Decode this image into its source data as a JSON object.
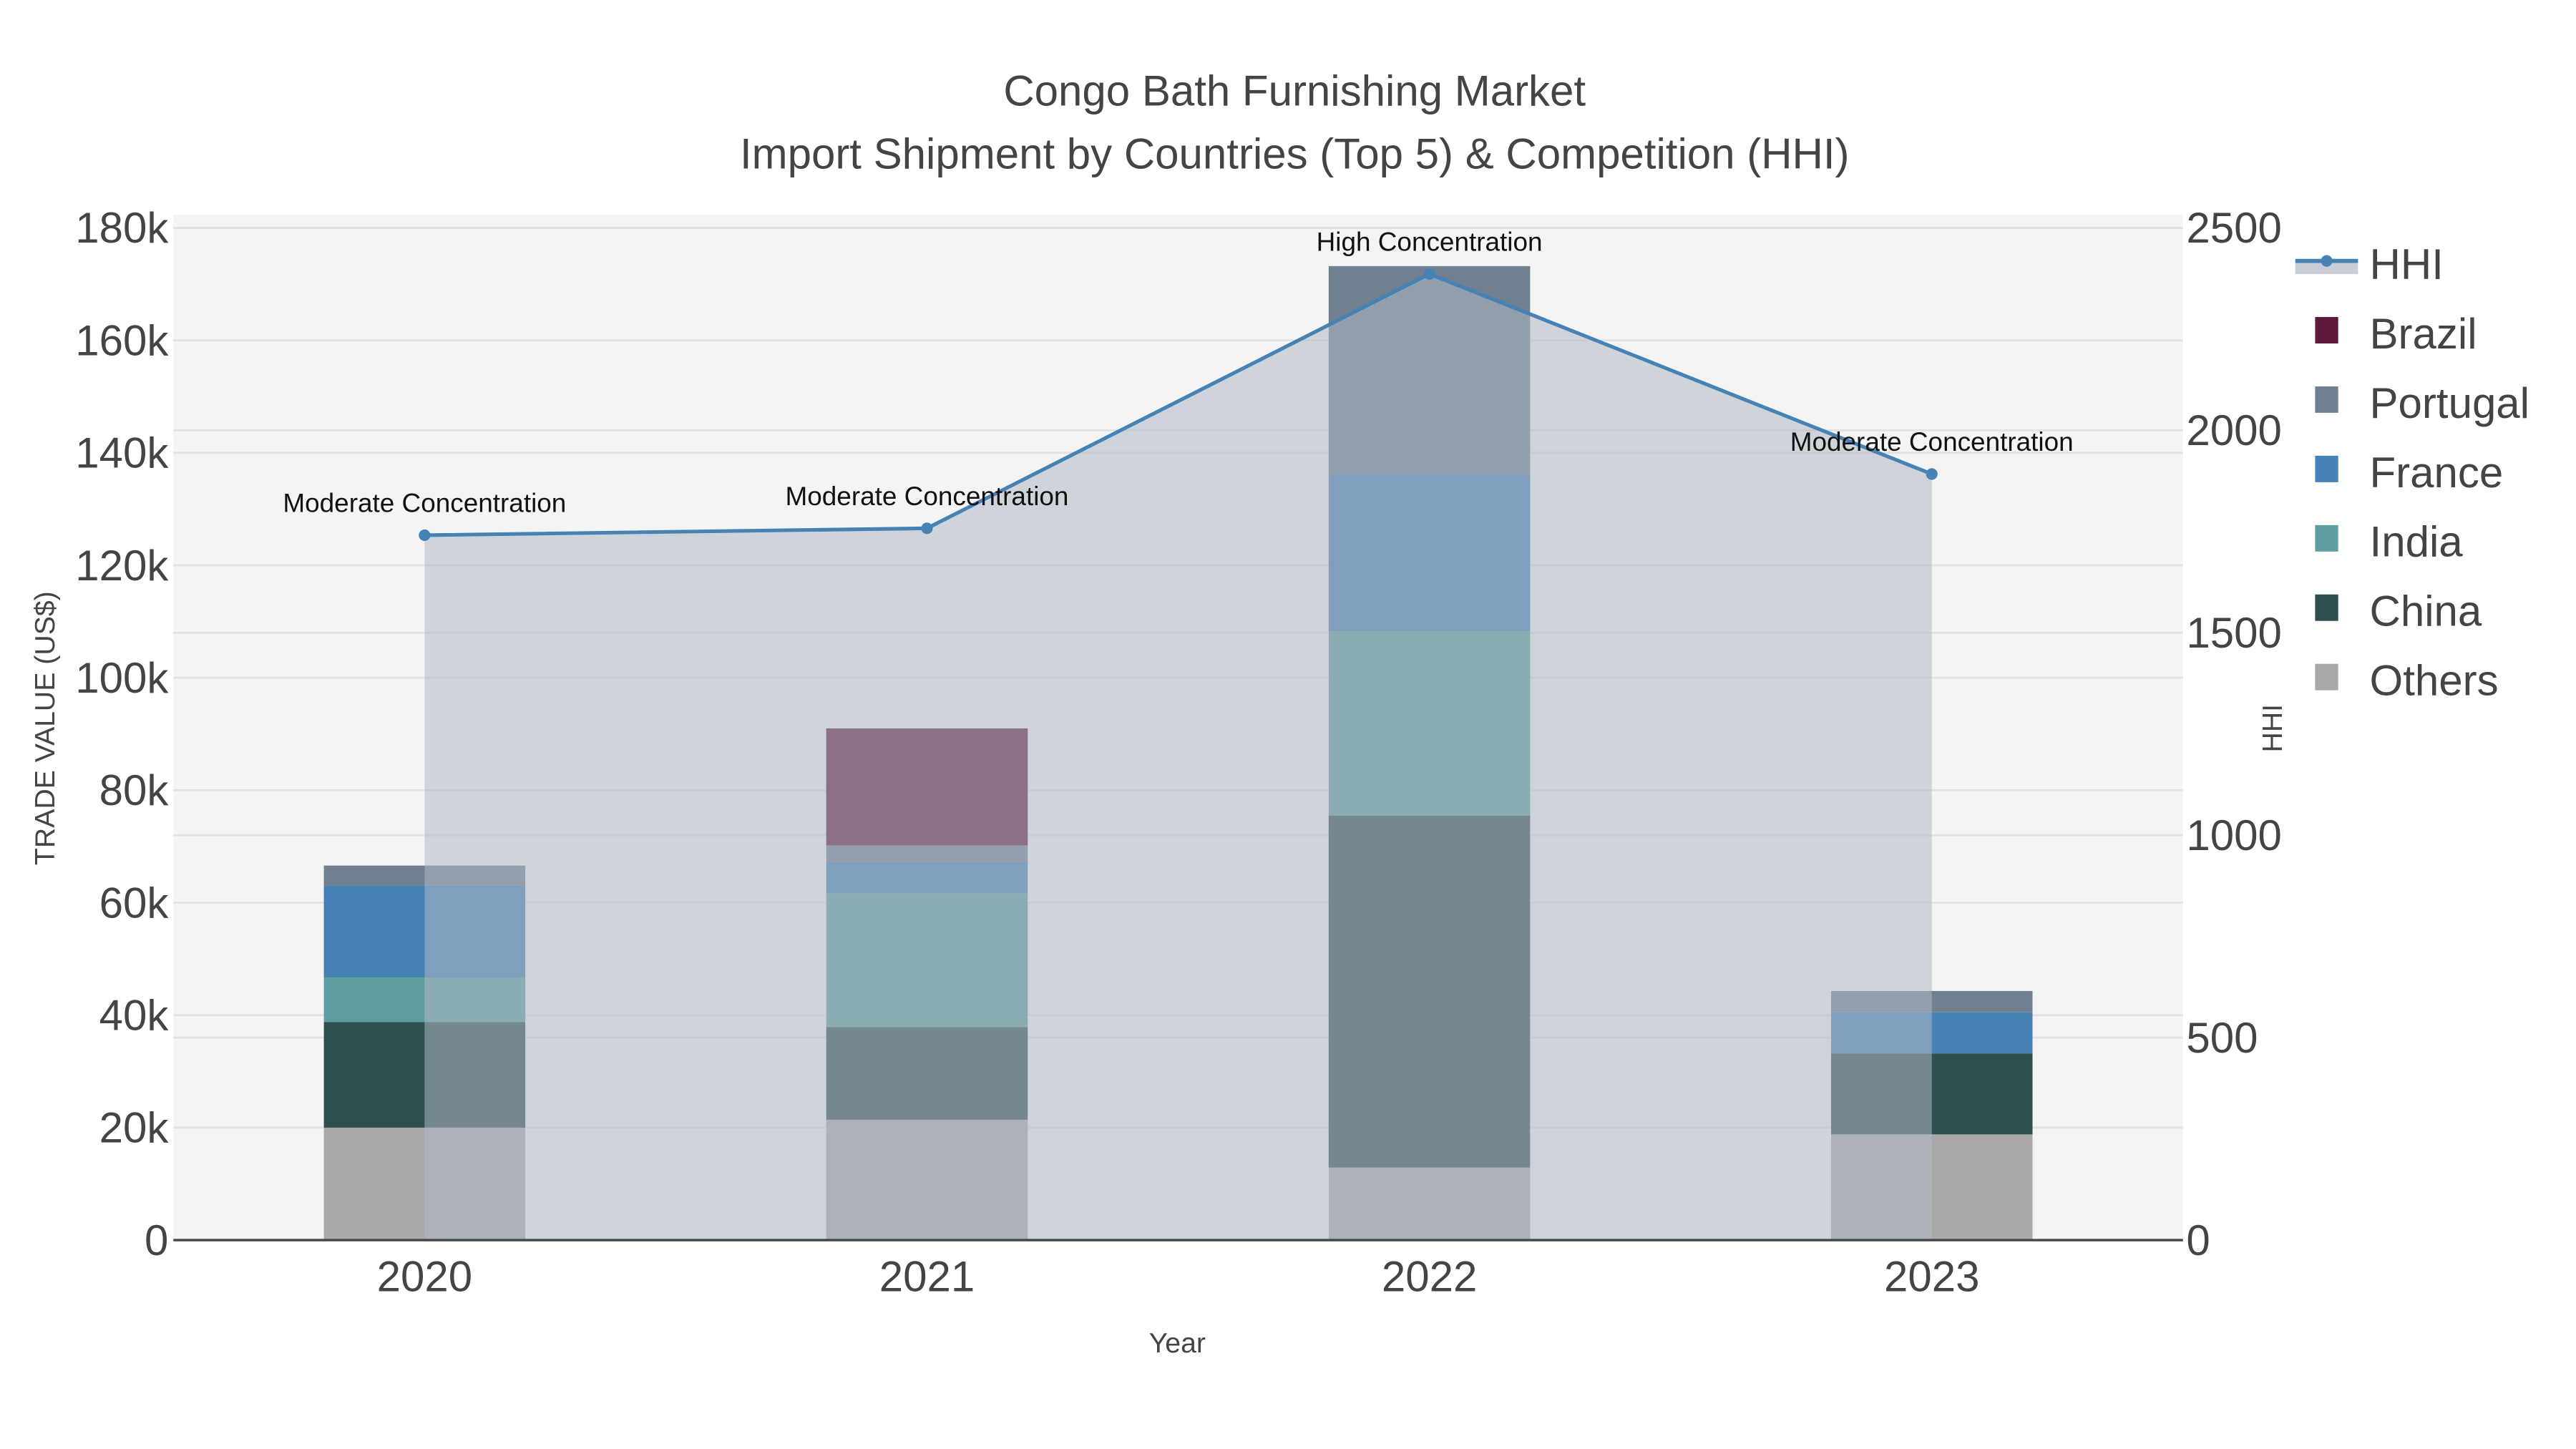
{
  "chart_data": {
    "type": "bar",
    "barmode": "stack",
    "title": "Congo Bath Furnishing Market",
    "subtitle": "Import Shipment by Countries (Top 5) & Competition (HHI)",
    "xlabel": "Year",
    "ylabel": "TRADE VALUE (US$)",
    "y2label": "HHI",
    "categories": [
      "2020",
      "2021",
      "2022",
      "2023"
    ],
    "ylim": [
      0,
      180000
    ],
    "y2lim": [
      0,
      2500
    ],
    "yticks": [
      0,
      20000,
      40000,
      60000,
      80000,
      100000,
      120000,
      140000,
      160000,
      180000
    ],
    "ytick_labels": [
      "0",
      "20k",
      "40k",
      "60k",
      "80k",
      "100k",
      "120k",
      "140k",
      "160k",
      "180k"
    ],
    "y2ticks": [
      0,
      500,
      1000,
      1500,
      2000,
      2500
    ],
    "y2tick_labels": [
      "0",
      "500",
      "1000",
      "1500",
      "2000",
      "2500"
    ],
    "grid": true,
    "legend_position": "right",
    "series": [
      {
        "name": "Others",
        "color": "#a9a9a9",
        "values": [
          20000,
          21400,
          12900,
          18800
        ]
      },
      {
        "name": "China",
        "color": "#2f4f4f",
        "values": [
          18800,
          16500,
          62600,
          14400
        ]
      },
      {
        "name": "India",
        "color": "#5f9ea0",
        "values": [
          7900,
          23800,
          32800,
          0
        ]
      },
      {
        "name": "France",
        "color": "#4682b4",
        "values": [
          16400,
          5500,
          27900,
          7300
        ]
      },
      {
        "name": "Portugal",
        "color": "#708090",
        "values": [
          3500,
          3000,
          37000,
          3800
        ]
      },
      {
        "name": "Brazil",
        "color": "#5e1a3b",
        "values": [
          0,
          20800,
          0,
          0
        ]
      }
    ],
    "hhi": {
      "name": "HHI",
      "color": "#4682b4",
      "values": [
        1741,
        1758,
        2386,
        1892
      ],
      "annotations": [
        "Moderate Concentration",
        "Moderate Concentration",
        "High Concentration",
        "Moderate Concentration"
      ]
    },
    "legend_order": [
      "HHI",
      "Brazil",
      "Portugal",
      "France",
      "India",
      "China",
      "Others"
    ]
  }
}
